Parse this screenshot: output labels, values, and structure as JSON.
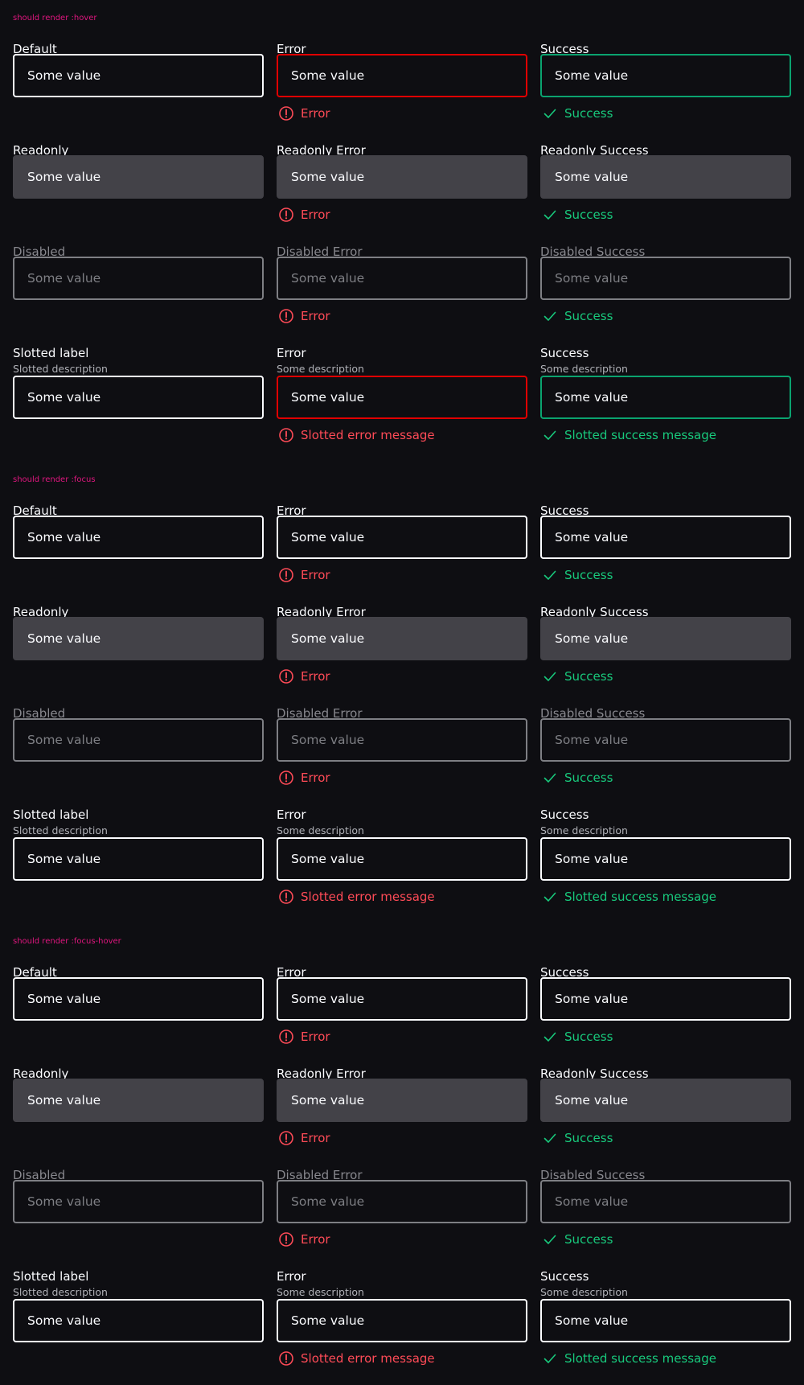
{
  "input_value": "Some value",
  "colors": {
    "error": "#ff4b57",
    "error_border": "#e00000",
    "success": "#18c97c",
    "success_border": "#0aa36f",
    "section_title": "#e0167f",
    "readonly_bg": "#434248"
  },
  "sections": [
    {
      "title": "should render :hover",
      "groups": [
        {
          "fields": [
            {
              "label": "Default",
              "state": "default"
            },
            {
              "label": "Error",
              "state": "error",
              "message": "Error"
            },
            {
              "label": "Success",
              "state": "success",
              "message": "Success"
            }
          ]
        },
        {
          "fields": [
            {
              "label": "Readonly",
              "state": "readonly"
            },
            {
              "label": "Readonly Error",
              "state": "readonly-error",
              "message": "Error"
            },
            {
              "label": "Readonly Success",
              "state": "readonly-success",
              "message": "Success"
            }
          ]
        },
        {
          "fields": [
            {
              "label": "Disabled",
              "state": "disabled"
            },
            {
              "label": "Disabled Error",
              "state": "disabled-error",
              "message": "Error"
            },
            {
              "label": "Disabled Success",
              "state": "disabled-success",
              "message": "Success"
            }
          ]
        },
        {
          "fields": [
            {
              "label": "Slotted label",
              "description": "Slotted description",
              "state": "default"
            },
            {
              "label": "Error",
              "description": "Some description",
              "state": "error",
              "message": "Slotted error message"
            },
            {
              "label": "Success",
              "description": "Some description",
              "state": "success",
              "message": "Slotted success message"
            }
          ]
        }
      ]
    },
    {
      "title": "should render :focus",
      "groups": [
        {
          "fields": [
            {
              "label": "Default",
              "state": "default"
            },
            {
              "label": "Error",
              "state": "focus-error",
              "message": "Error"
            },
            {
              "label": "Success",
              "state": "focus-success",
              "message": "Success"
            }
          ]
        },
        {
          "fields": [
            {
              "label": "Readonly",
              "state": "readonly"
            },
            {
              "label": "Readonly Error",
              "state": "readonly-error",
              "message": "Error"
            },
            {
              "label": "Readonly Success",
              "state": "readonly-success",
              "message": "Success"
            }
          ]
        },
        {
          "fields": [
            {
              "label": "Disabled",
              "state": "disabled"
            },
            {
              "label": "Disabled Error",
              "state": "disabled-error",
              "message": "Error"
            },
            {
              "label": "Disabled Success",
              "state": "disabled-success",
              "message": "Success"
            }
          ]
        },
        {
          "fields": [
            {
              "label": "Slotted label",
              "description": "Slotted description",
              "state": "default"
            },
            {
              "label": "Error",
              "description": "Some description",
              "state": "focus-error",
              "message": "Slotted error message"
            },
            {
              "label": "Success",
              "description": "Some description",
              "state": "focus-success",
              "message": "Slotted success message"
            }
          ]
        }
      ]
    },
    {
      "title": "should render :focus-hover",
      "groups": [
        {
          "fields": [
            {
              "label": "Default",
              "state": "default"
            },
            {
              "label": "Error",
              "state": "focus-error",
              "message": "Error"
            },
            {
              "label": "Success",
              "state": "focus-success",
              "message": "Success"
            }
          ]
        },
        {
          "fields": [
            {
              "label": "Readonly",
              "state": "readonly"
            },
            {
              "label": "Readonly Error",
              "state": "readonly-error",
              "message": "Error"
            },
            {
              "label": "Readonly Success",
              "state": "readonly-success",
              "message": "Success"
            }
          ]
        },
        {
          "fields": [
            {
              "label": "Disabled",
              "state": "disabled"
            },
            {
              "label": "Disabled Error",
              "state": "disabled-error",
              "message": "Error"
            },
            {
              "label": "Disabled Success",
              "state": "disabled-success",
              "message": "Success"
            }
          ]
        },
        {
          "fields": [
            {
              "label": "Slotted label",
              "description": "Slotted description",
              "state": "default"
            },
            {
              "label": "Error",
              "description": "Some description",
              "state": "focus-error",
              "message": "Slotted error message"
            },
            {
              "label": "Success",
              "description": "Some description",
              "state": "focus-success",
              "message": "Slotted success message"
            }
          ]
        }
      ]
    }
  ]
}
